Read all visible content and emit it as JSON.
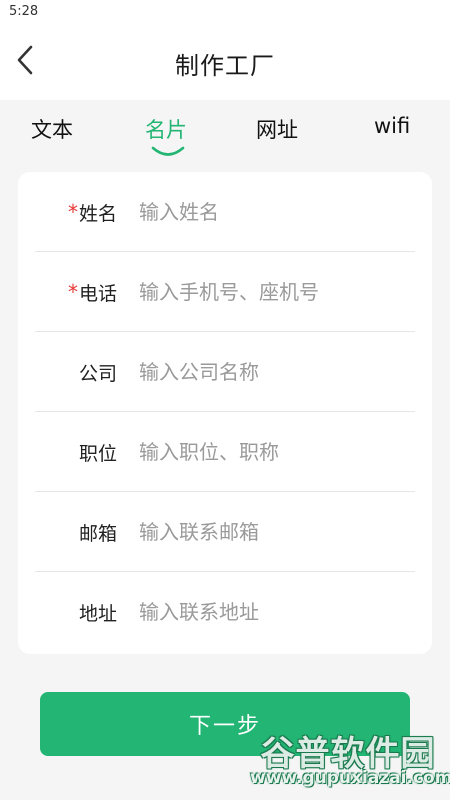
{
  "status_bar": {
    "time": "5:28"
  },
  "header": {
    "title": "制作工厂",
    "back_icon": "chevron-left-icon"
  },
  "tabs": [
    {
      "label": "文本",
      "active": false
    },
    {
      "label": "名片",
      "active": true
    },
    {
      "label": "网址",
      "active": false
    },
    {
      "label": "wifi",
      "active": false
    }
  ],
  "form": {
    "rows": [
      {
        "label": "姓名",
        "required": true,
        "required_mark": "*",
        "value": "",
        "placeholder": "输入姓名"
      },
      {
        "label": "电话",
        "required": true,
        "required_mark": "*",
        "value": "",
        "placeholder": "输入手机号、座机号"
      },
      {
        "label": "公司",
        "required": false,
        "required_mark": "",
        "value": "",
        "placeholder": "输入公司名称"
      },
      {
        "label": "职位",
        "required": false,
        "required_mark": "",
        "value": "",
        "placeholder": "输入职位、职称"
      },
      {
        "label": "邮箱",
        "required": false,
        "required_mark": "",
        "value": "",
        "placeholder": "输入联系邮箱"
      },
      {
        "label": "地址",
        "required": false,
        "required_mark": "",
        "value": "",
        "placeholder": "输入联系地址"
      }
    ]
  },
  "next_button": {
    "label": "下一步"
  },
  "watermark": {
    "title": "谷普软件园",
    "url": "www.gupuxiazai.com"
  },
  "colors": {
    "accent": "#22b573",
    "required": "#e53935",
    "background": "#f5f5f5"
  }
}
